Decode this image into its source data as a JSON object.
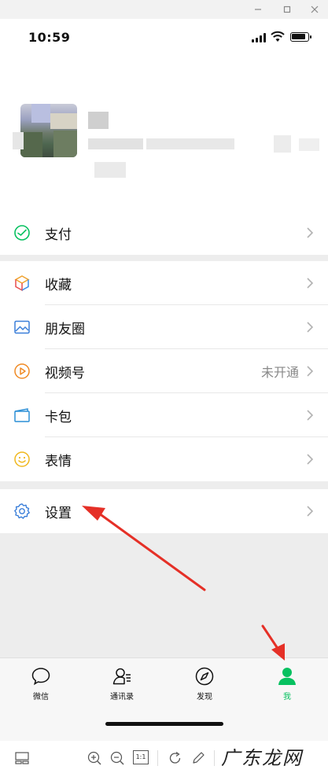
{
  "status_bar": {
    "time": "10:59"
  },
  "menu": {
    "pay": {
      "label": "支付"
    },
    "items": [
      {
        "label": "收藏",
        "icon": "cube-icon"
      },
      {
        "label": "朋友圈",
        "icon": "image-icon"
      },
      {
        "label": "视频号",
        "icon": "play-circle-icon",
        "value": "未开通"
      },
      {
        "label": "卡包",
        "icon": "card-wallet-icon"
      },
      {
        "label": "表情",
        "icon": "smiley-icon"
      }
    ],
    "settings": {
      "label": "设置"
    }
  },
  "tabbar": {
    "tabs": [
      {
        "label": "微信",
        "icon": "chat-bubble-icon"
      },
      {
        "label": "通讯录",
        "icon": "contacts-icon"
      },
      {
        "label": "发现",
        "icon": "compass-icon"
      },
      {
        "label": "我",
        "icon": "person-icon",
        "active": true
      }
    ]
  },
  "toolbar": {
    "zoom_reset": "1:1",
    "watermark": "广东龙网"
  },
  "colors": {
    "brand_green": "#07c160",
    "annotation_red": "#e53027"
  }
}
